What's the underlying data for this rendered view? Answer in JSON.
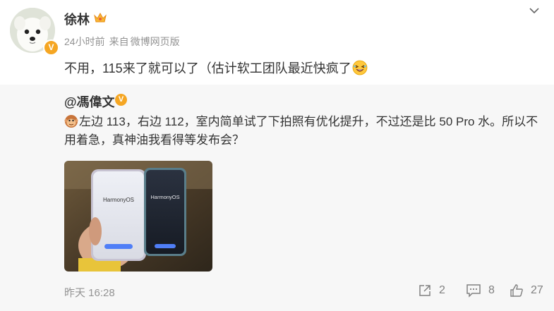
{
  "post": {
    "username": "徐林",
    "time_ago": "24小时前",
    "source_prefix": "来自",
    "source": "微博网页版",
    "text": "不用，115来了就可以了（估计软工团队最近快疯了"
  },
  "repost": {
    "username": "@馮偉文",
    "text": "左边 113，右边 112，室内简单试了下拍照有优化提升，不过还是比 50 Pro 水。所以不用着急，真神油我看得等发布会？",
    "time": "昨天 16:28",
    "photo": {
      "left_phone_brand": "HarmonyOS",
      "right_phone_brand": "HarmonyOS"
    },
    "actions": {
      "repost_count": "2",
      "comment_count": "8",
      "like_count": "27"
    }
  },
  "colors": {
    "badge": "#f5a623",
    "meta_text": "#939393",
    "repost_bg": "#f7f7f7"
  }
}
